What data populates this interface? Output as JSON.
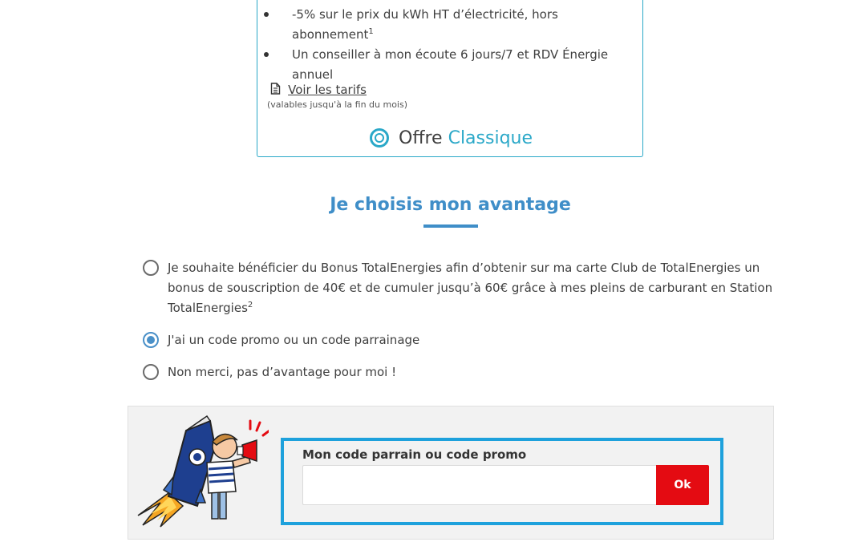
{
  "offer": {
    "benefits": [
      {
        "text": "-5% sur le prix du kWh HT d’électricité, hors abonnement",
        "sup": "1"
      },
      {
        "text": "Un conseiller à mon écoute 6 jours/7 et RDV Énergie annuel",
        "sup": ""
      }
    ],
    "tarifs_link": "Voir les tarifs",
    "tarifs_note": "(valables jusqu'à la fin du mois)",
    "title_prefix": "Offre",
    "title_accent": "Classique"
  },
  "advantage": {
    "title": "Je choisis mon avantage",
    "options": [
      {
        "label": "Je souhaite bénéficier du Bonus TotalEnergies afin d’obtenir sur ma carte Club de TotalEnergies un bonus de souscription de 40€ et de cumuler jusqu’à 60€ grâce à mes pleins de carburant en Station TotalEnergies",
        "sup": "2",
        "checked": false
      },
      {
        "label": "J'ai un code promo ou un code parrainage",
        "sup": "",
        "checked": true
      },
      {
        "label": "Non merci, pas d’avantage pour moi !",
        "sup": "",
        "checked": false
      }
    ]
  },
  "promo": {
    "label": "Mon code parrain ou code promo",
    "input_value": "",
    "ok_label": "Ok"
  },
  "colors": {
    "accent_cyan": "#2aa8c8",
    "title_blue": "#3f8ec8",
    "promo_border": "#1ea1dc",
    "ok_red": "#e40b12"
  }
}
